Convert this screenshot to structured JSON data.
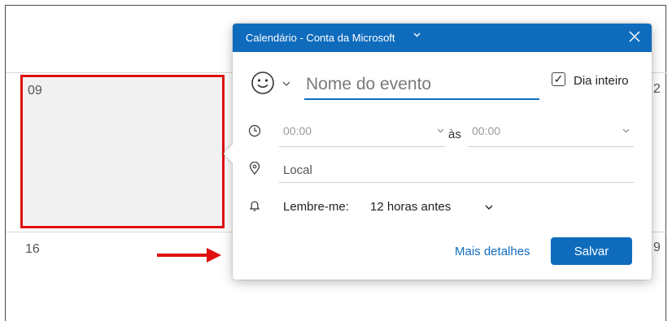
{
  "calendar": {
    "cells": [
      {
        "day": "09"
      },
      {
        "day": "16"
      }
    ],
    "peek_right": [
      "2",
      "9"
    ]
  },
  "popup": {
    "title": "Calendário - Conta da Microsoft",
    "title_chevron_icon": "chevron-down-icon",
    "close_icon": "close-icon",
    "emoji_icon": "smiley-icon",
    "event_name_placeholder": "Nome do evento",
    "all_day": {
      "label": "Dia inteiro",
      "checked": true,
      "check_glyph": "✓"
    },
    "start_time": "00:00",
    "end_time": "00:00",
    "time_separator": "às",
    "location_placeholder": "Local",
    "reminder_label": "Lembre-me:",
    "reminder_value": "12 horas antes",
    "more_details": "Mais detalhes",
    "save": "Salvar"
  },
  "colors": {
    "accent": "#0f6cbd",
    "highlight": "#e01010",
    "selected_cell_bg": "#f1f1f1"
  }
}
